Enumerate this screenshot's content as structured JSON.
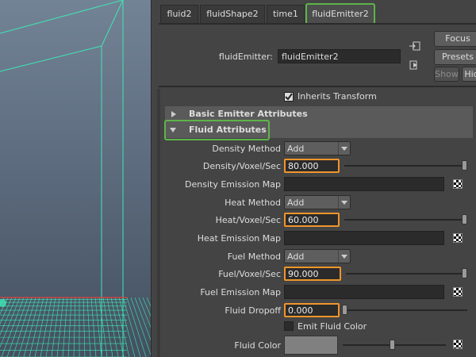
{
  "tabs": [
    "fluid2",
    "fluidShape2",
    "time1",
    "fluidEmitter2"
  ],
  "header": {
    "node_label": "fluidEmitter:",
    "node_value": "fluidEmitter2",
    "focus_label": "Focus",
    "presets_label": "Presets",
    "show_label": "Show",
    "hide_label": "Hid"
  },
  "inherits_transform": {
    "label": "Inherits Transform",
    "checked": true
  },
  "sections": {
    "basic": "Basic Emitter Attributes",
    "fluid": "Fluid Attributes"
  },
  "attributes": {
    "density_method": {
      "label": "Density Method",
      "value": "Add"
    },
    "density_rate": {
      "label": "Density/Voxel/Sec",
      "value": "80.000"
    },
    "density_map": {
      "label": "Density Emission Map"
    },
    "heat_method": {
      "label": "Heat Method",
      "value": "Add"
    },
    "heat_rate": {
      "label": "Heat/Voxel/Sec",
      "value": "60.000"
    },
    "heat_map": {
      "label": "Heat Emission Map"
    },
    "fuel_method": {
      "label": "Fuel Method",
      "value": "Add"
    },
    "fuel_rate": {
      "label": "Fuel/Voxel/Sec",
      "value": "90.000"
    },
    "fuel_map": {
      "label": "Fuel Emission Map"
    },
    "dropoff": {
      "label": "Fluid Dropoff",
      "value": "0.000"
    },
    "emit_color": {
      "label": "Emit Fluid Color",
      "checked": false
    },
    "fluid_color": {
      "label": "Fluid Color",
      "swatch": "#808080"
    }
  },
  "colors": {
    "highlight_green": "#5fb34a",
    "highlight_orange": "#f0952a",
    "wire_cyan": "#3ee6b4",
    "axis_red": "#e04040"
  }
}
